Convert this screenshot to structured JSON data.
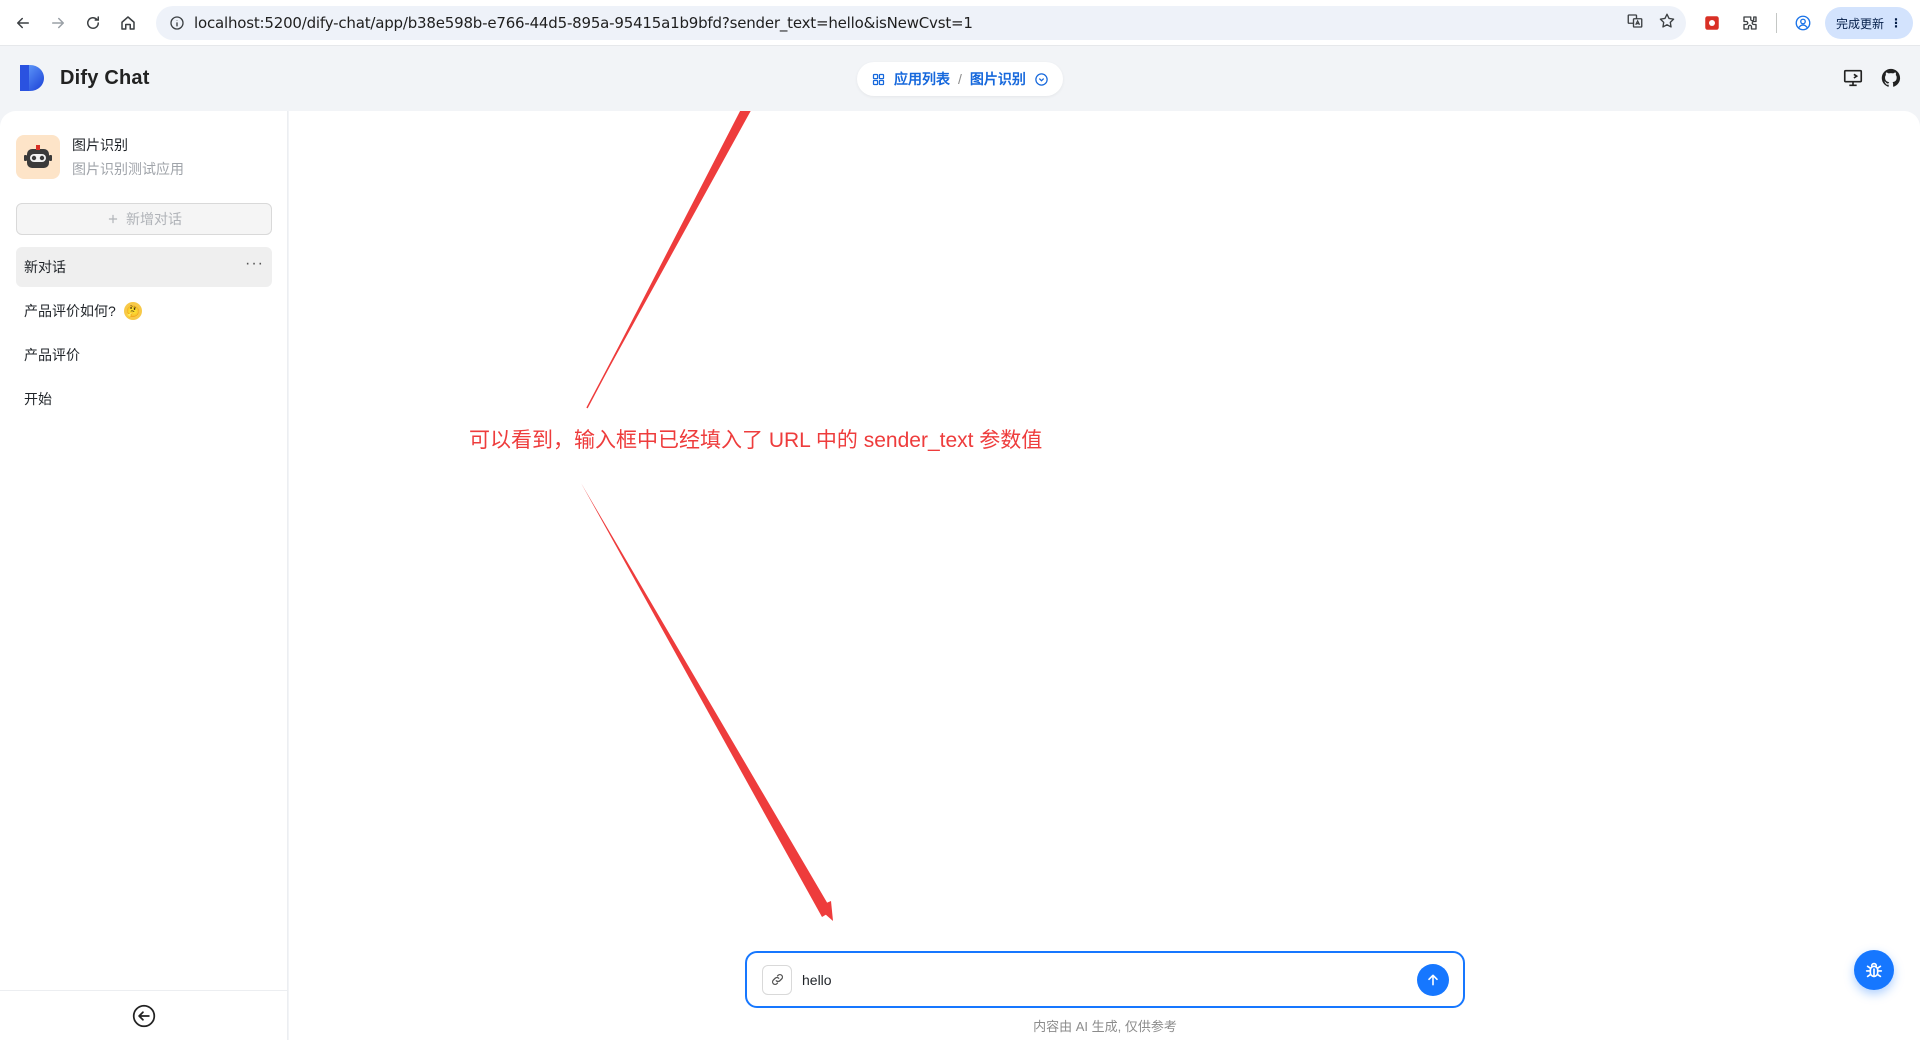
{
  "browser": {
    "url": "localhost:5200/dify-chat/app/b38e598b-e766-44d5-895a-95415a1b9bfd?sender_text=hello&isNewCvst=1",
    "update_label": "完成更新"
  },
  "header": {
    "brand_name": "Dify Chat",
    "breadcrumb_apps": "应用列表",
    "breadcrumb_separator": "/",
    "breadcrumb_current": "图片识别"
  },
  "sidebar": {
    "app_name": "图片识别",
    "app_desc": "图片识别测试应用",
    "new_chat_label": "新增对话",
    "conversations": [
      {
        "label": "新对话",
        "active": true
      },
      {
        "label": "产品评价如何?",
        "emoji": "🤔"
      },
      {
        "label": "产品评价"
      },
      {
        "label": "开始"
      }
    ],
    "more_label": "···"
  },
  "main": {
    "annotation": "可以看到，输入框中已经填入了 URL 中的 sender_text 参数值",
    "sender_value": "hello",
    "disclaimer": "内容由 AI 生成, 仅供参考"
  },
  "colors": {
    "accent": "#1677ff",
    "annotation": "#ee3c3c",
    "breadcrumb": "#1668dc"
  },
  "icons": [
    "back-icon",
    "forward-icon",
    "reload-icon",
    "home-icon",
    "info-icon",
    "translate-icon",
    "star-icon",
    "extension-icon",
    "profile-icon",
    "menu-dots-icon",
    "apps-grid-icon",
    "chevron-down-circle-icon",
    "desktop-icon",
    "github-icon",
    "plus-icon",
    "collapse-sidebar-icon",
    "link-icon",
    "arrow-up-icon",
    "bug-icon"
  ]
}
